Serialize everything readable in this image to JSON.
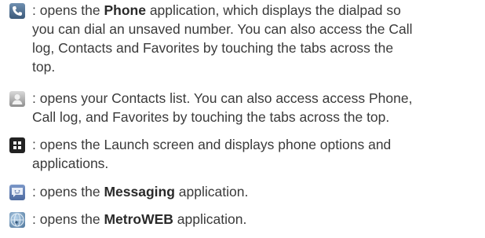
{
  "entries": [
    {
      "icon": "phone-icon",
      "prefix": ": opens the ",
      "app": "Phone",
      "line1_suffix": " application, which displays the dialpad so",
      "lines": [
        "you can dial an unsaved number. You can also access the Call",
        "log, Contacts and Favorites by touching the tabs across the",
        "top."
      ]
    },
    {
      "icon": "contacts-icon",
      "line1": ": opens your Contacts list. You can also access access Phone,",
      "lines": [
        "Call log, and Favorites by touching the tabs across the top."
      ]
    },
    {
      "icon": "launch-grid-icon",
      "line1": ": opens the Launch screen and displays phone options and",
      "lines": [
        "applications."
      ]
    },
    {
      "icon": "messaging-icon",
      "prefix": ": opens the ",
      "app": "Messaging",
      "line1_suffix": " application."
    },
    {
      "icon": "metroweb-icon",
      "prefix": ": opens the ",
      "app": "MetroWEB",
      "line1_suffix": " application."
    }
  ]
}
